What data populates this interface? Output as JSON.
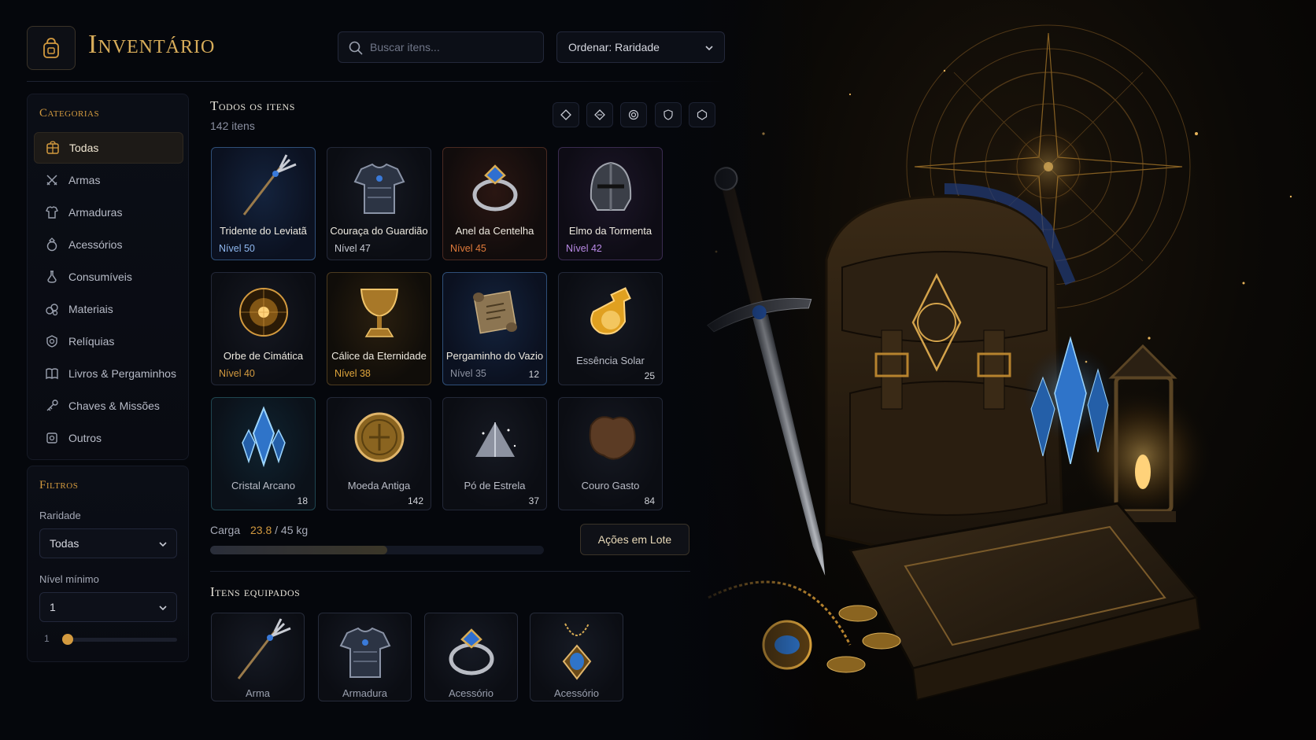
{
  "header": {
    "title": "Inventário",
    "search_placeholder": "Buscar itens...",
    "sort_label": "Ordenar: Raridade"
  },
  "categories": {
    "title": "Categorias",
    "items": [
      {
        "label": "Todas",
        "icon": "grid-chest-icon",
        "active": true
      },
      {
        "label": "Armas",
        "icon": "crossed-swords-icon"
      },
      {
        "label": "Armaduras",
        "icon": "armor-icon"
      },
      {
        "label": "Acessórios",
        "icon": "ring-icon"
      },
      {
        "label": "Consumíveis",
        "icon": "potion-icon"
      },
      {
        "label": "Materiais",
        "icon": "materials-icon"
      },
      {
        "label": "Relíquias",
        "icon": "relic-icon"
      },
      {
        "label": "Livros & Pergaminhos",
        "icon": "book-icon"
      },
      {
        "label": "Chaves & Missões",
        "icon": "key-icon"
      },
      {
        "label": "Outros",
        "icon": "misc-icon"
      }
    ]
  },
  "filters": {
    "title": "Filtros",
    "rarity_label": "Raridade",
    "rarity_value": "Todas",
    "min_level_label": "Nível mínimo",
    "min_level_value": "1",
    "slider_value": "1"
  },
  "main": {
    "section_title": "Todos os itens",
    "item_count": "142 itens",
    "view_icons": [
      "diamond-outline-icon",
      "diamond-icon",
      "target-icon",
      "shield-icon",
      "hexagon-icon"
    ],
    "items": [
      {
        "name": "Tridente do Leviatã",
        "level_label": "Nível",
        "level": "50",
        "qty": "",
        "rarity": "blue",
        "level_color": "#8fb8f0",
        "icon": "trident-icon"
      },
      {
        "name": "Couraça do Guardião",
        "level_label": "Nível",
        "level": "47",
        "qty": "",
        "rarity": "plain",
        "level_color": "#c7cad3",
        "icon": "armor-icon"
      },
      {
        "name": "Anel da Centelha",
        "level_label": "Nível",
        "level": "45",
        "qty": "",
        "rarity": "red",
        "level_color": "#e07a3a",
        "icon": "ring-icon"
      },
      {
        "name": "Elmo da Tormenta",
        "level_label": "Nível",
        "level": "42",
        "qty": "",
        "rarity": "purple",
        "level_color": "#b98ae6",
        "icon": "helmet-icon"
      },
      {
        "name": "Orbe de Cimática",
        "level_label": "Nível",
        "level": "40",
        "qty": "",
        "rarity": "plain",
        "level_color": "#d39a3f",
        "icon": "orb-icon"
      },
      {
        "name": "Cálice da Eternidade",
        "level_label": "Nível",
        "level": "38",
        "qty": "",
        "rarity": "gold",
        "level_color": "#e0a63c",
        "icon": "chalice-icon"
      },
      {
        "name": "Pergaminho do Vazio",
        "level_label": "Nível",
        "level": "35",
        "qty": "12",
        "rarity": "blue",
        "level_color": "#8d92a1",
        "icon": "scroll-icon"
      },
      {
        "name": "Essência Solar",
        "level_label": "",
        "level": "",
        "qty": "25",
        "rarity": "plain",
        "level_color": "#8d92a1",
        "icon": "potion-icon"
      },
      {
        "name": "Cristal Arcano",
        "level_label": "",
        "level": "",
        "qty": "18",
        "rarity": "teal",
        "level_color": "#8d92a1",
        "icon": "crystal-icon"
      },
      {
        "name": "Moeda Antiga",
        "level_label": "",
        "level": "",
        "qty": "142",
        "rarity": "plain",
        "level_color": "#8d92a1",
        "icon": "coin-icon"
      },
      {
        "name": "Pó de Estrela",
        "level_label": "",
        "level": "",
        "qty": "37",
        "rarity": "plain",
        "level_color": "#8d92a1",
        "icon": "stardust-icon"
      },
      {
        "name": "Couro Gasto",
        "level_label": "",
        "level": "",
        "qty": "84",
        "rarity": "plain",
        "level_color": "#8d92a1",
        "icon": "leather-icon"
      }
    ],
    "carga": {
      "label": "Carga",
      "current": "23.8",
      "max": "/ 45 kg",
      "fraction": 0.53
    },
    "bulk_button": "Ações em Lote",
    "equipped_title": "Itens equipados",
    "equipped": [
      {
        "label": "Arma",
        "icon": "trident-icon"
      },
      {
        "label": "Armadura",
        "icon": "armor-icon"
      },
      {
        "label": "Acessório",
        "icon": "ring-icon"
      },
      {
        "label": "Acessório",
        "icon": "amulet-icon"
      }
    ]
  },
  "colors": {
    "accent": "#d39a3f",
    "background": "#05070c",
    "panel": "#0b0e16"
  }
}
